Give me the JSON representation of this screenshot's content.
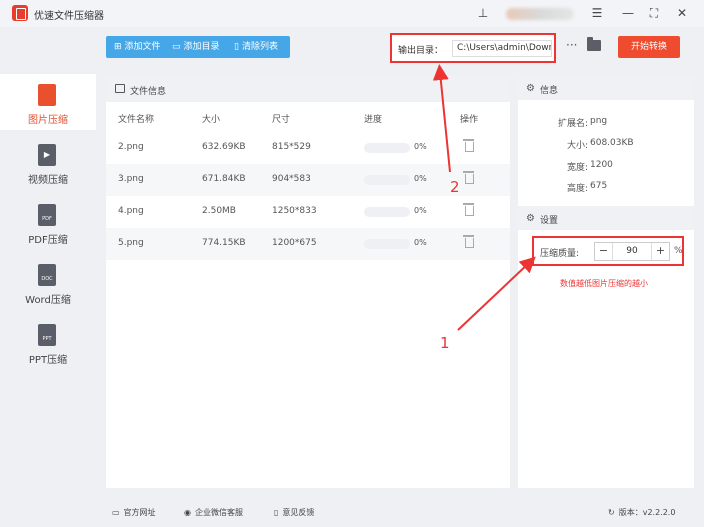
{
  "window": {
    "title": "优速文件压缩器",
    "controls": [
      "menu-icon",
      "minimize-icon",
      "maximize-icon",
      "close-icon"
    ]
  },
  "sidebar": {
    "items": [
      {
        "label": "图片压缩",
        "badge": "",
        "active": true
      },
      {
        "label": "视频压缩",
        "badge": "▶",
        "active": false
      },
      {
        "label": "PDF压缩",
        "badge": "PDF",
        "active": false
      },
      {
        "label": "Word压缩",
        "badge": "DOC",
        "active": false
      },
      {
        "label": "PPT压缩",
        "badge": "PPT",
        "active": false
      }
    ]
  },
  "toolbar": {
    "add_file": "添加文件",
    "add_dir": "添加目录",
    "clear_list": "清除列表"
  },
  "output": {
    "label": "输出目录：",
    "path": "C:\\Users\\admin\\Downlo",
    "more": "···"
  },
  "start_button": "开始转换",
  "file_panel": {
    "title": "文件信息",
    "columns": [
      "文件名称",
      "大小",
      "尺寸",
      "进度",
      "操作"
    ],
    "rows": [
      {
        "name": "2.png",
        "size": "632.69KB",
        "dims": "815*529",
        "progress": 0,
        "progress_text": "0%"
      },
      {
        "name": "3.png",
        "size": "671.84KB",
        "dims": "904*583",
        "progress": 0,
        "progress_text": "0%"
      },
      {
        "name": "4.png",
        "size": "2.50MB",
        "dims": "1250*833",
        "progress": 0,
        "progress_text": "0%"
      },
      {
        "name": "5.png",
        "size": "774.15KB",
        "dims": "1200*675",
        "progress": 0,
        "progress_text": "0%"
      }
    ]
  },
  "info_panel": {
    "title": "信息",
    "fields": [
      {
        "key": "扩展名:",
        "value": "png"
      },
      {
        "key": "大小:",
        "value": "608.03KB"
      },
      {
        "key": "宽度:",
        "value": "1200"
      },
      {
        "key": "高度:",
        "value": "675"
      }
    ]
  },
  "settings": {
    "title": "设置",
    "quality_label": "压缩质量:",
    "quality_value": "90",
    "minus": "−",
    "plus": "+",
    "unit": "%",
    "hint": "数值越低图片压缩的越小"
  },
  "annotations": {
    "one": "1",
    "two": "2"
  },
  "statusbar": {
    "website": "官方网址",
    "wechat": "企业微信客服",
    "feedback": "意见反馈",
    "version_label": "版本：",
    "version": "v2.2.2.0"
  },
  "colors": {
    "accent_blue": "#46a7e8",
    "accent_orange": "#ef4b2f",
    "annotation_red": "#e33333"
  }
}
